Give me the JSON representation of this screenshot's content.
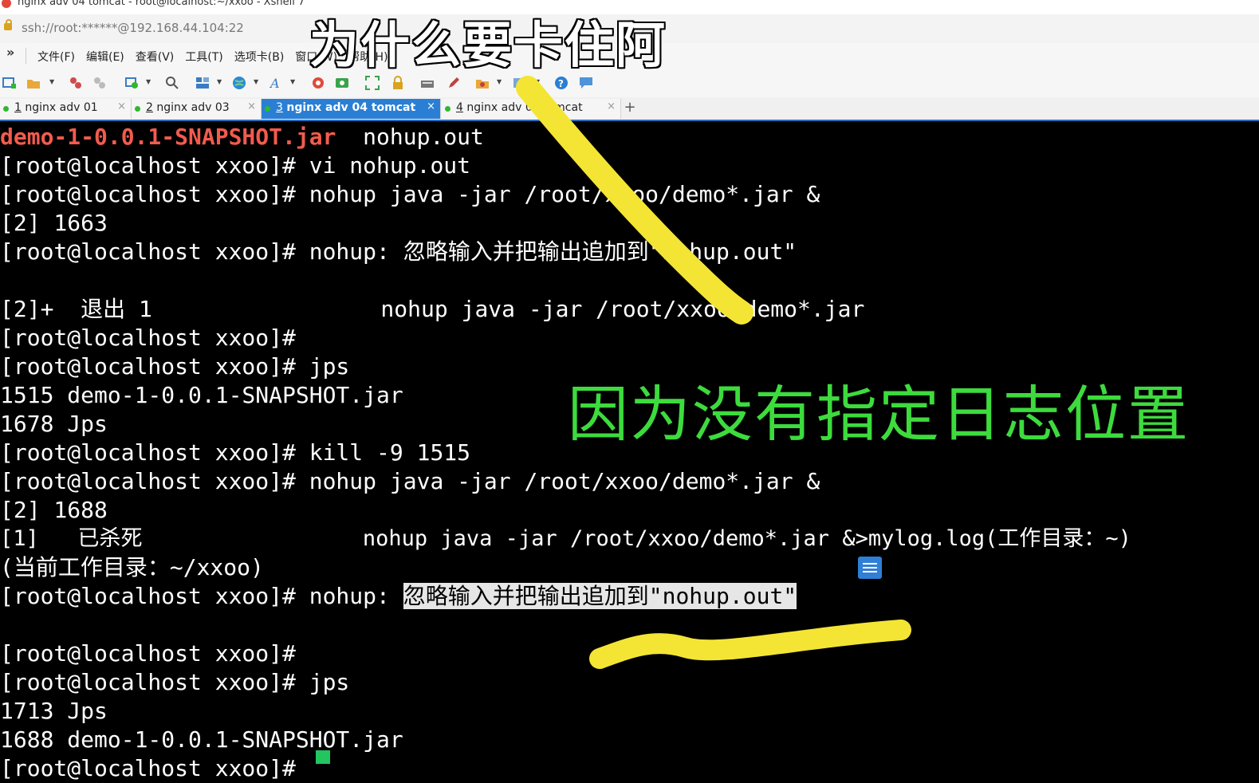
{
  "window": {
    "title": "nginx adv 04 tomcat - root@localhost:~/xxoo - Xshell 7",
    "address": "ssh://root:******@192.168.44.104:22"
  },
  "menu": [
    "文件(F)",
    "编辑(E)",
    "查看(V)",
    "工具(T)",
    "选项卡(B)",
    "窗口(W)",
    "帮助(H)"
  ],
  "tabs": [
    {
      "num": "1",
      "label": "nginx adv 01",
      "active": false
    },
    {
      "num": "2",
      "label": "nginx adv 03",
      "active": false
    },
    {
      "num": "3",
      "label": "nginx adv 04 tomcat",
      "active": true
    },
    {
      "num": "4",
      "label": "nginx adv 04 tomcat",
      "active": false
    }
  ],
  "tab_add": "+",
  "tab_close": "×",
  "terminal": {
    "line1_red": "demo-1-0.0.1-SNAPSHOT.jar",
    "line1_rest": "  nohup.out",
    "lines": [
      "[root@localhost xxoo]# vi nohup.out",
      "[root@localhost xxoo]# nohup java -jar /root/xxoo/demo*.jar &",
      "[2] 1663",
      "[root@localhost xxoo]# nohup: 忽略输入并把输出追加到\"nohup.out\"",
      "",
      "[2]+  退出 1                 nohup java -jar /root/xxoo/demo*.jar",
      "[root@localhost xxoo]#",
      "[root@localhost xxoo]# jps",
      "1515 demo-1-0.0.1-SNAPSHOT.jar",
      "1678 Jps",
      "[root@localhost xxoo]# kill -9 1515",
      "[root@localhost xxoo]# nohup java -jar /root/xxoo/demo*.jar &",
      "[2] 1688",
      "[1]   已杀死                 nohup java -jar /root/xxoo/demo*.jar &>mylog.log(工作目录：~)",
      "(当前工作目录：~/xxoo)"
    ],
    "sel_prefix": "[root@localhost xxoo]# nohup: ",
    "sel_text": "忽略输入并把输出追加到\"nohup.out\"",
    "lines_after": [
      "",
      "[root@localhost xxoo]#",
      "[root@localhost xxoo]# jps",
      "1713 Jps",
      "1688 demo-1-0.0.1-SNAPSHOT.jar",
      "[root@localhost xxoo]# "
    ]
  },
  "overlay": {
    "caption_top": "为什么要卡住阿",
    "caption_mid": "因为没有指定日志位置",
    "highlight_color": "#f4e534",
    "caption_mid_color": "#3ddb3d"
  }
}
